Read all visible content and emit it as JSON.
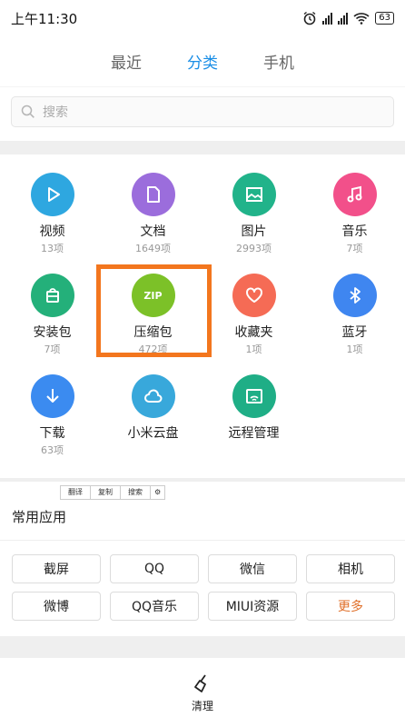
{
  "status": {
    "time": "上午11:30",
    "battery": "63"
  },
  "tabs": [
    {
      "label": "最近",
      "active": false
    },
    {
      "label": "分类",
      "active": true
    },
    {
      "label": "手机",
      "active": false
    }
  ],
  "search": {
    "placeholder": "搜索"
  },
  "categories": [
    {
      "name": "视频",
      "count": "13项",
      "color": "#2ea7e0",
      "icon": "play-icon"
    },
    {
      "name": "文档",
      "count": "1649项",
      "color": "#9b6ddc",
      "icon": "document-icon"
    },
    {
      "name": "图片",
      "count": "2993项",
      "color": "#21b38a",
      "icon": "image-icon"
    },
    {
      "name": "音乐",
      "count": "7项",
      "color": "#f2508a",
      "icon": "music-icon"
    },
    {
      "name": "安装包",
      "count": "7项",
      "color": "#24b07a",
      "icon": "package-icon"
    },
    {
      "name": "压缩包",
      "count": "472项",
      "color": "#7cc128",
      "icon": "zip-icon",
      "icon_text": "ZIP"
    },
    {
      "name": "收藏夹",
      "count": "1项",
      "color": "#f56b55",
      "icon": "heart-icon"
    },
    {
      "name": "蓝牙",
      "count": "1项",
      "color": "#3f86f0",
      "icon": "bluetooth-icon"
    },
    {
      "name": "下载",
      "count": "63项",
      "color": "#3b8bf0",
      "icon": "download-icon"
    },
    {
      "name": "小米云盘",
      "count": "",
      "color": "#38a8db",
      "icon": "cloud-icon"
    },
    {
      "name": "远程管理",
      "count": "",
      "color": "#1fae86",
      "icon": "remote-icon"
    }
  ],
  "context_menu": [
    "翻译",
    "复制",
    "搜索"
  ],
  "apps": {
    "title": "常用应用",
    "items": [
      "截屏",
      "QQ",
      "微信",
      "相机",
      "微博",
      "QQ音乐",
      "MIUI资源",
      "更多"
    ]
  },
  "bottom": {
    "clean_label": "清理"
  }
}
